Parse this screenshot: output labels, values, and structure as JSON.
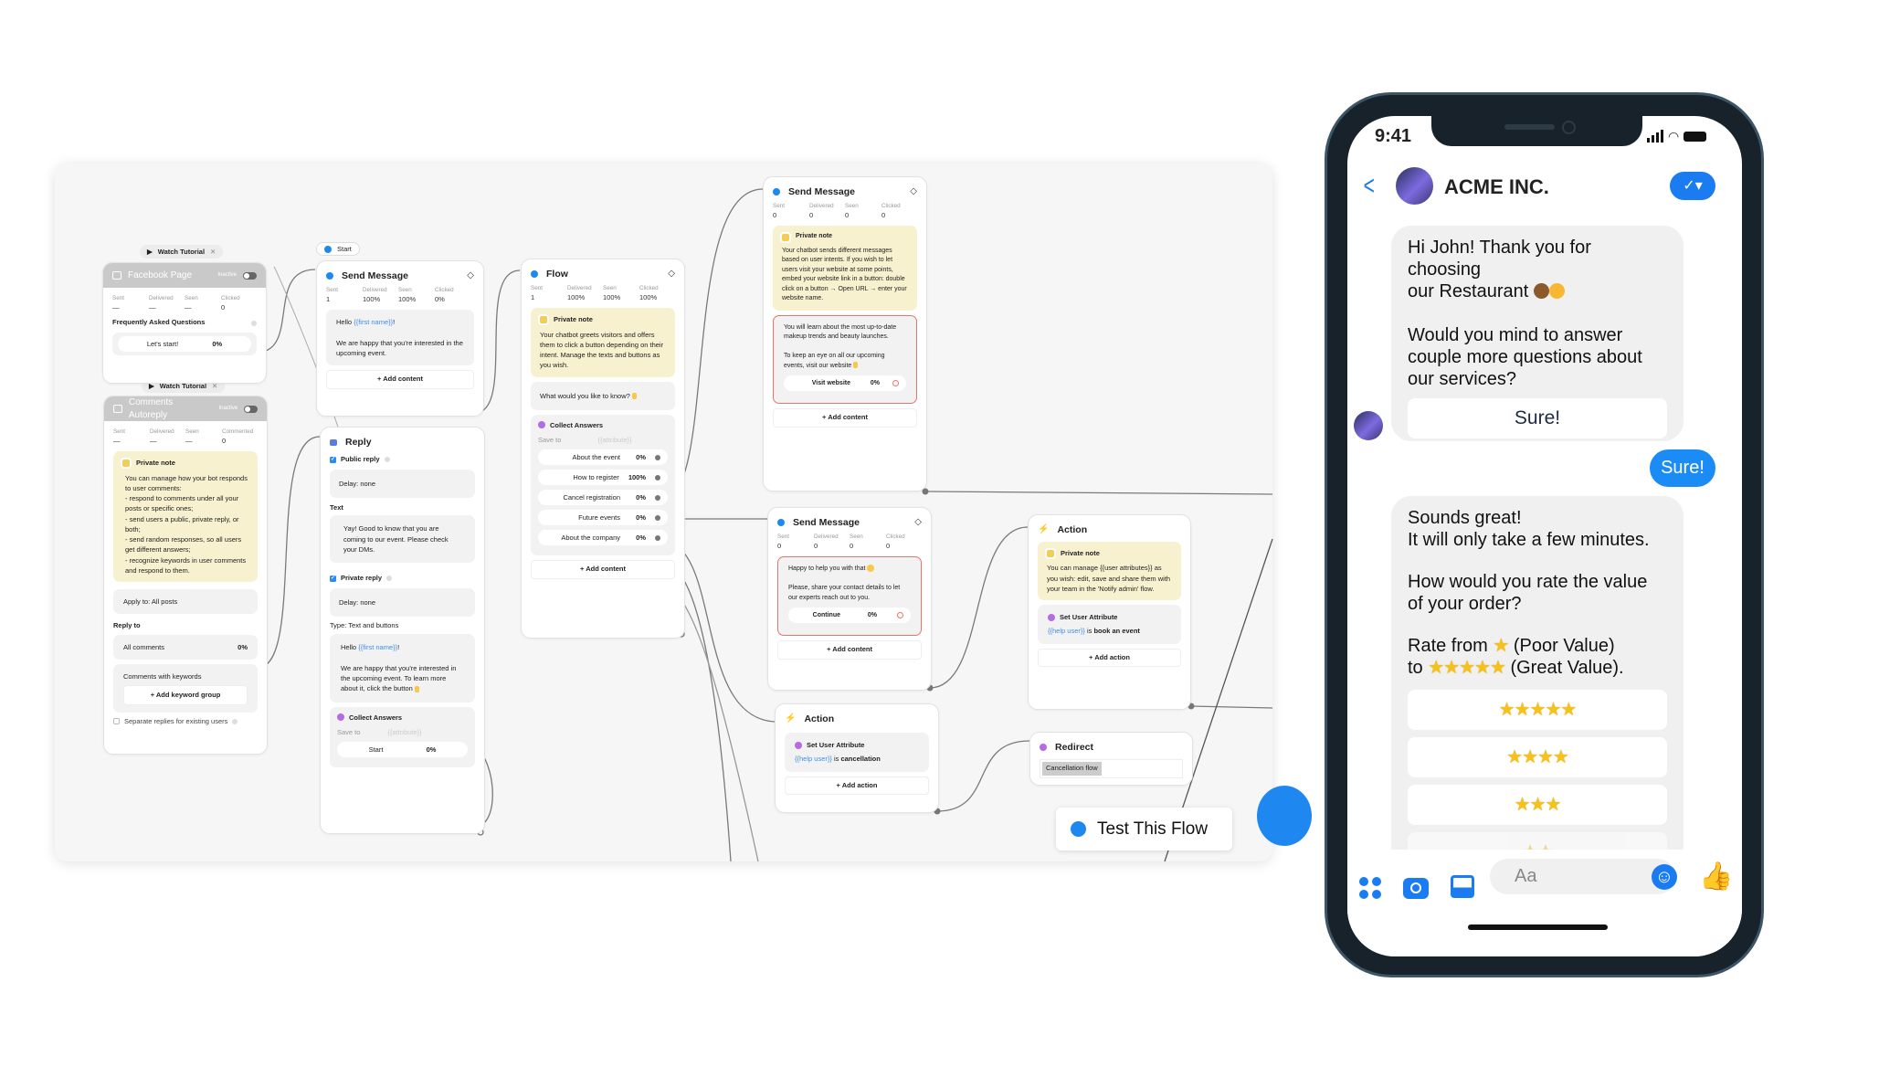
{
  "flow_builder": {
    "test_button": "Test This Flow",
    "start_label": "Start",
    "watch_tutorial": "Watch Tutorial",
    "facebook_page": {
      "title": "Facebook Page",
      "status": "Inactive",
      "stats": [
        {
          "label": "Sent",
          "value": "—"
        },
        {
          "label": "Delivered",
          "value": "—"
        },
        {
          "label": "Seen",
          "value": "—"
        },
        {
          "label": "Clicked",
          "value": "0"
        }
      ],
      "section": "Frequently Asked Questions",
      "button": {
        "label": "Let's start!",
        "pct": "0%"
      }
    },
    "comments_autoreply": {
      "title": "Comments Autoreply",
      "status": "Inactive",
      "stats": [
        {
          "label": "Sent",
          "value": "—"
        },
        {
          "label": "Delivered",
          "value": "—"
        },
        {
          "label": "Seen",
          "value": "—"
        },
        {
          "label": "Commented",
          "value": "0"
        }
      ],
      "note_title": "Private note",
      "note": "You can manage how your bot responds to user comments:\n- respond to comments under all your posts or specific ones;\n- send users a public, private reply, or both;\n- send random responses, so all users get different answers;\n- recognize keywords in user comments and respond to them.",
      "apply_to": "Apply to: All posts",
      "reply_to": "Reply to",
      "all_comments": "All comments",
      "all_comments_pct": "0%",
      "keywords": "Comments with keywords",
      "add_keyword": "+ Add keyword group",
      "separate": "Separate replies for existing users"
    },
    "send_message_1": {
      "title": "Send Message",
      "stats": [
        {
          "label": "Sent",
          "value": "1"
        },
        {
          "label": "Delivered",
          "value": "100%"
        },
        {
          "label": "Seen",
          "value": "100%"
        },
        {
          "label": "Clicked",
          "value": "0%"
        }
      ],
      "hello": "Hello ",
      "var": "{{first name}}",
      "excl": "!",
      "text": "We are happy that you're interested in the upcoming event.",
      "add": "+ Add content"
    },
    "reply": {
      "title": "Reply",
      "public_reply": "Public reply",
      "delay1": "Delay: none",
      "text_label": "Text",
      "text": "Yay! Good to know that you are coming to our event. Please check your DMs.",
      "private_reply": "Private reply",
      "delay2": "Delay: none",
      "type": "Type:  Text and buttons",
      "hello": "Hello ",
      "var": "{{first name}}",
      "excl": "!",
      "msg": "We are happy that you're interested in the upcoming event. To learn more about it, click the button",
      "collect": "Collect Answers",
      "save_to": "Save to",
      "attr": "{{attribute}}",
      "button": {
        "label": "Start",
        "pct": "0%"
      }
    },
    "flow": {
      "title": "Flow",
      "stats": [
        {
          "label": "Sent",
          "value": "1"
        },
        {
          "label": "Delivered",
          "value": "100%"
        },
        {
          "label": "Seen",
          "value": "100%"
        },
        {
          "label": "Clicked",
          "value": "100%"
        }
      ],
      "note_title": "Private note",
      "note": "Your chatbot greets visitors and offers them to click a button depending on their intent. Manage the texts and buttons as you wish.",
      "question": "What would you like to know?",
      "collect": "Collect Answers",
      "save_to": "Save to",
      "attr": "{{attribute}}",
      "options": [
        {
          "label": "About the event",
          "pct": "0%"
        },
        {
          "label": "How to register",
          "pct": "100%"
        },
        {
          "label": "Cancel registration",
          "pct": "0%"
        },
        {
          "label": "Future events",
          "pct": "0%"
        },
        {
          "label": "About the company",
          "pct": "0%"
        }
      ],
      "add": "+ Add content"
    },
    "send_message_2": {
      "title": "Send Message",
      "stats": [
        {
          "label": "Sent",
          "value": "0"
        },
        {
          "label": "Delivered",
          "value": "0"
        },
        {
          "label": "Seen",
          "value": "0"
        },
        {
          "label": "Clicked",
          "value": "0"
        }
      ],
      "note_title": "Private note",
      "note": "Your chatbot sends different messages based on user intents. If you wish to let users visit your website at some points, embed your website link in a button: double click on a button → Open URL → enter your website name.",
      "msg1": "You will learn about the most up-to-date makeup trends and beauty launches.",
      "msg2": "To keep an eye on all our upcoming events, visit our website",
      "button": {
        "label": "Visit website",
        "pct": "0%"
      },
      "add": "+ Add content"
    },
    "send_message_3": {
      "title": "Send Message",
      "stats": [
        {
          "label": "Sent",
          "value": "0"
        },
        {
          "label": "Delivered",
          "value": "0"
        },
        {
          "label": "Seen",
          "value": "0"
        },
        {
          "label": "Clicked",
          "value": "0"
        }
      ],
      "msg1": "Happy to help you with that",
      "msg2": "Please, share your contact details to let our experts reach out to you.",
      "button": {
        "label": "Continue",
        "pct": "0%"
      },
      "add": "+ Add content"
    },
    "action_1": {
      "title": "Action",
      "attr_title": "Set User Attribute",
      "var": "{{help user}}",
      "is": " is ",
      "value": "cancellation",
      "add": "+ Add action"
    },
    "action_2": {
      "title": "Action",
      "note_title": "Private note",
      "note": "You can manage {{user attributes}} as you wish: edit, save and share them with your team in the 'Notify admin' flow.",
      "attr_title": "Set User Attribute",
      "var": "{{help user}}",
      "is": " is ",
      "value": "book an event",
      "add": "+ Add action"
    },
    "redirect": {
      "title": "Redirect",
      "target": "Cancellation flow"
    }
  },
  "phone": {
    "time": "9:41",
    "contact": "ACME INC.",
    "composer_placeholder": "Aa",
    "accent": "#1b7cf2",
    "messages": {
      "bot1_l1": "Hi John! Thank you for choosing",
      "bot1_l2": "our Restaurant",
      "bot1_p2": "Would you mind to answer couple more questions about our services?",
      "quick_reply": "Sure!",
      "user_reply": "Sure!",
      "bot2_p1": "Sounds great!\nIt will only take a few minutes.",
      "bot2_p2": "How would you rate the value of your order?",
      "rate_from": "Rate from ",
      "poor": " (Poor Value)",
      "to": "to ",
      "great": " (Great Value).",
      "one_star": "★",
      "five_star": "★★★★★",
      "ratings": [
        "★★★★★",
        "★★★★",
        "★★★",
        "★★"
      ]
    }
  }
}
